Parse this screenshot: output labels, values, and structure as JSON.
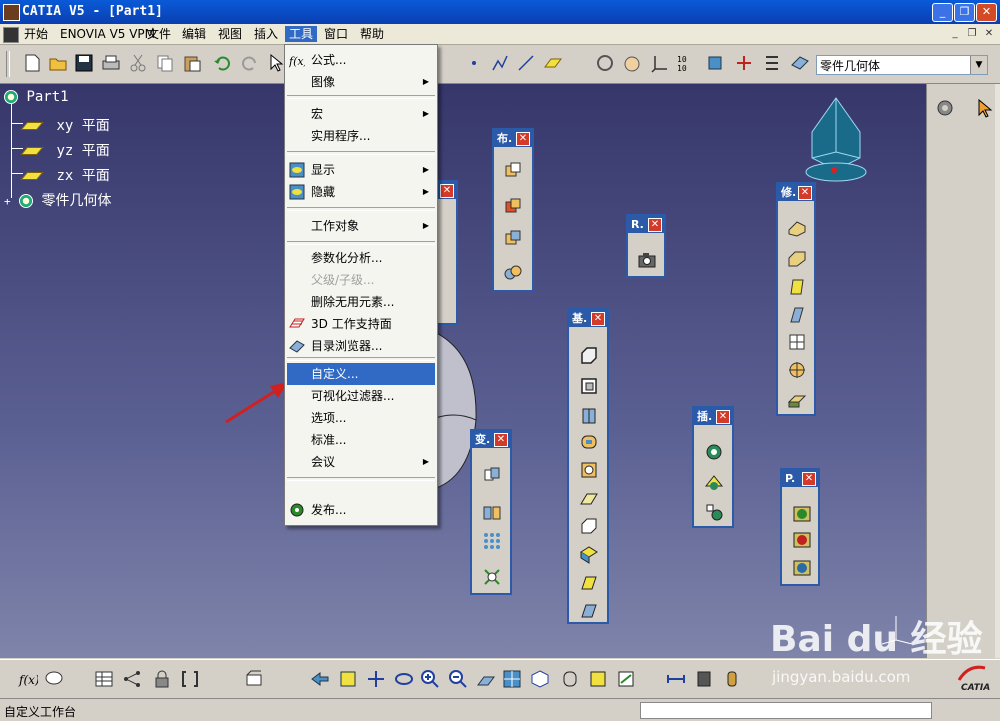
{
  "window": {
    "title": "CATIA V5 - [Part1]",
    "min": "_",
    "restore": "❐",
    "close": "✕"
  },
  "menubar": {
    "items": [
      "开始",
      "ENOVIA V5 VPM",
      "文件",
      "编辑",
      "视图",
      "插入",
      "工具",
      "窗口",
      "帮助"
    ],
    "active_index": 6,
    "mdi": {
      "min": "_",
      "restore": "❐",
      "close": "✕"
    }
  },
  "toolbar": {
    "combo_value": "零件几何体"
  },
  "tree": {
    "root": "Part1",
    "items": [
      "xy 平面",
      "yz 平面",
      "zx 平面",
      "零件几何体"
    ]
  },
  "tools_menu": {
    "items": [
      {
        "label": "公式...",
        "icon": "fx-icon",
        "submenu": false,
        "disabled": false
      },
      {
        "label": "图像",
        "submenu": true,
        "disabled": false
      },
      {
        "label": "宏",
        "submenu": true,
        "disabled": false
      },
      {
        "label": "实用程序...",
        "submenu": false,
        "disabled": false
      },
      {
        "label": "显示",
        "submenu": true,
        "disabled": false
      },
      {
        "label": "隐藏",
        "submenu": true,
        "disabled": false
      },
      {
        "label": "工作对象",
        "submenu": true,
        "disabled": false
      },
      {
        "label": "参数化分析...",
        "submenu": false,
        "disabled": false
      },
      {
        "label": "父级/子级...",
        "submenu": false,
        "disabled": true
      },
      {
        "label": "删除无用元素...",
        "submenu": false,
        "disabled": false
      },
      {
        "label": "3D 工作支持面",
        "submenu": false,
        "disabled": false
      },
      {
        "label": "目录浏览器...",
        "submenu": false,
        "disabled": false
      },
      {
        "label": "自定义...",
        "submenu": false,
        "disabled": false,
        "highlighted": true
      },
      {
        "label": "可视化过滤器...",
        "submenu": false,
        "disabled": false
      },
      {
        "label": "选项...",
        "submenu": false,
        "disabled": false
      },
      {
        "label": "标准...",
        "submenu": false,
        "disabled": false
      },
      {
        "label": "会议",
        "submenu": true,
        "disabled": false
      },
      {
        "label": "发布...",
        "submenu": false,
        "disabled": false
      }
    ]
  },
  "palettes": {
    "bu": "布.",
    "r": "R.",
    "xiu": "修.",
    "ji": "基.",
    "bian": "变.",
    "cha": "插.",
    "p": "P.",
    "close": "✕"
  },
  "statusbar": {
    "text": "自定义工作台"
  },
  "watermark": {
    "big": "Bai du 经验",
    "small": "jingyan.baidu.com"
  },
  "logo": {
    "text": "CATIA"
  },
  "colors": {
    "titlebar": "#0a4ccf",
    "highlight": "#316ac5",
    "viewport_top": "#36366a",
    "palette_header": "#2a5aa8"
  }
}
